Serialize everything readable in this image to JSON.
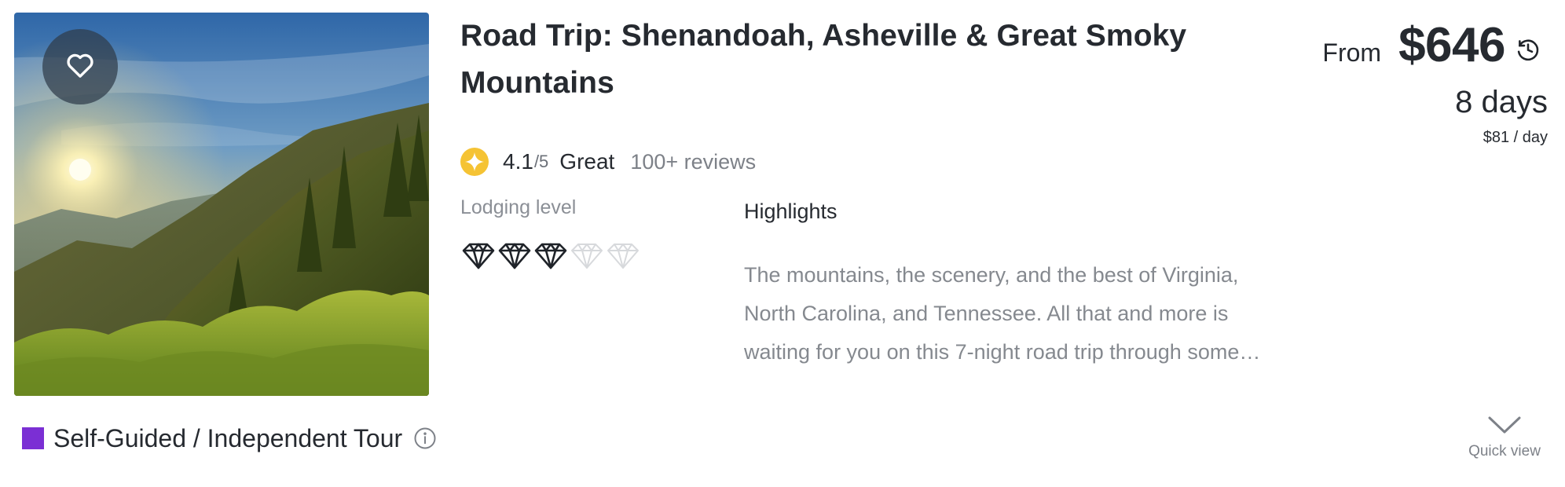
{
  "card": {
    "title": "Road Trip: Shenandoah, Asheville & Great Smoky Mountains",
    "image_alt": "Sunrise over forested mountain ridges",
    "favorite_icon": "heart-outline-icon",
    "rating": {
      "score": "4.1",
      "max": "/5",
      "label": "Great",
      "reviews": "100+ reviews",
      "icon": "rating-star-badge-icon",
      "icon_color": "#f5c334"
    },
    "lodging": {
      "label": "Lodging level",
      "level": 3,
      "max": 5
    },
    "highlights": {
      "title": "Highlights",
      "text": "The mountains, the scenery, and the best of Virginia, North Carolina, and Tennessee. All that and more is waiting for you on this 7-night road trip through some…"
    },
    "price": {
      "from_label": "From",
      "value": "$646",
      "history_icon": "price-history-icon",
      "duration": "8 days",
      "per_day": "$81 / day"
    },
    "tour_type": {
      "label": "Self-Guided / Independent Tour",
      "color": "#7b2fd4",
      "info_icon": "info-icon"
    },
    "quick_view": {
      "label": "Quick view",
      "icon": "chevron-down-icon"
    }
  }
}
